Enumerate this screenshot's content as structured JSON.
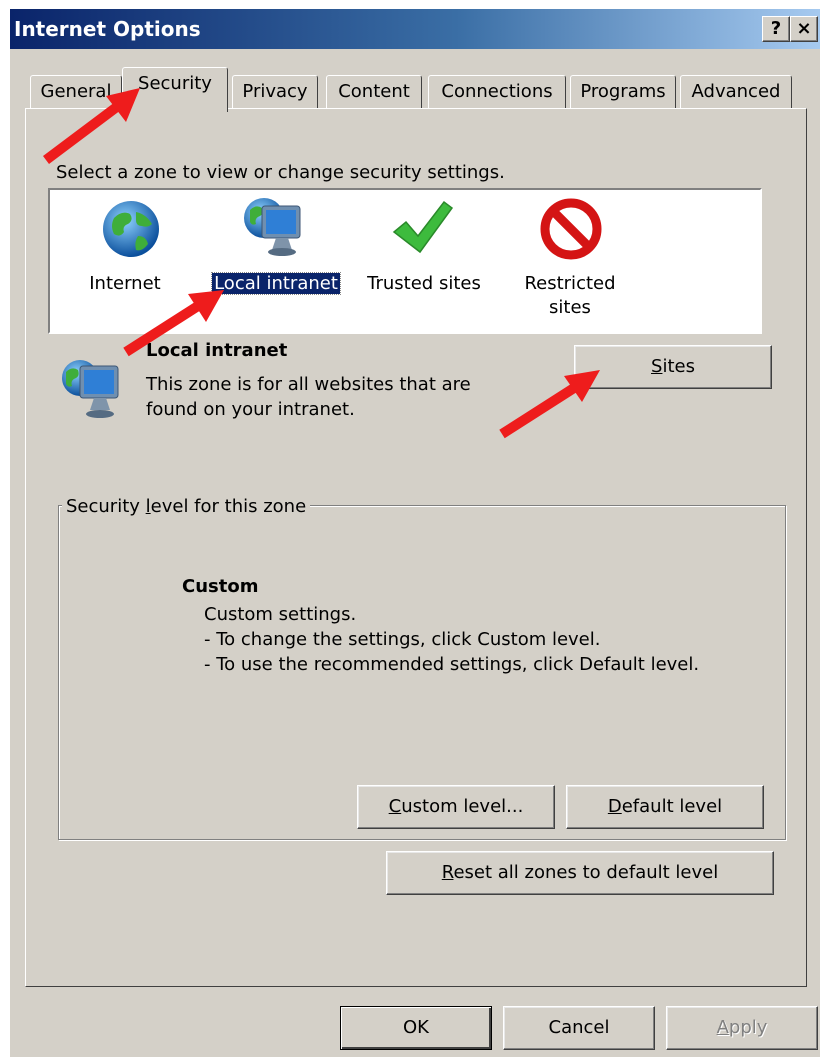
{
  "window": {
    "title": "Internet Options",
    "help_glyph": "?",
    "close_glyph": "×"
  },
  "tabs": [
    "General",
    "Security",
    "Privacy",
    "Content",
    "Connections",
    "Programs",
    "Advanced"
  ],
  "prompt": "Select a zone to view or change security settings.",
  "zones": [
    {
      "label": "Internet",
      "icon": "globe-icon"
    },
    {
      "label": "Local intranet",
      "icon": "intranet-icon",
      "selected": true
    },
    {
      "label": "Trusted sites",
      "icon": "checkmark-icon"
    },
    {
      "label": "Restricted",
      "label2": "sites",
      "icon": "restricted-icon"
    }
  ],
  "zone_info": {
    "name": "Local intranet",
    "line1": "This zone is for all websites that are",
    "line2": "found on your intranet."
  },
  "buttons": {
    "sites": {
      "accel": "S",
      "rest": "ites"
    },
    "custom_level": {
      "accel": "C",
      "rest": "ustom level..."
    },
    "default_level": {
      "accel": "D",
      "rest": "efault level"
    },
    "reset_all": {
      "accel": "R",
      "rest": "eset all zones to default level"
    },
    "ok": "OK",
    "cancel": "Cancel",
    "apply": {
      "accel": "A",
      "rest": "pply"
    }
  },
  "security_group": {
    "legend_pre": "Security ",
    "legend_accel": "l",
    "legend_post": "evel for this zone",
    "level_name": "Custom",
    "desc1": "Custom settings.",
    "desc2": "- To change the settings, click Custom level.",
    "desc3": "- To use the recommended settings, click Default level."
  },
  "colors": {
    "arrow": "#ee1c1c",
    "title_gradient_start": "#0a246a",
    "selection": "#0a246a",
    "face": "#d4d0c8"
  }
}
